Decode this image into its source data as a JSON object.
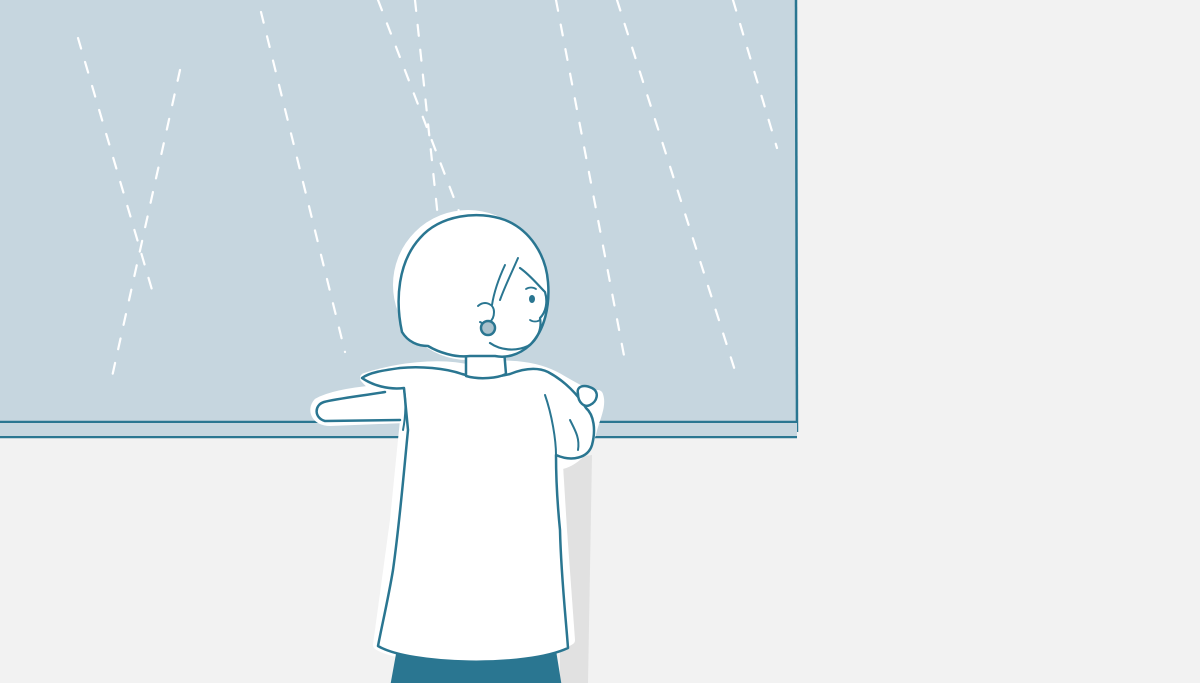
{
  "scene": {
    "description": "",
    "colors": {
      "wall": "#f2f2f2",
      "window_glass": "#c6d6df",
      "outline": "#2a7691",
      "shirt": "#ffffff",
      "pants": "#2a7691",
      "rain": "#ffffff",
      "shadow": "#e1e1e1"
    }
  }
}
